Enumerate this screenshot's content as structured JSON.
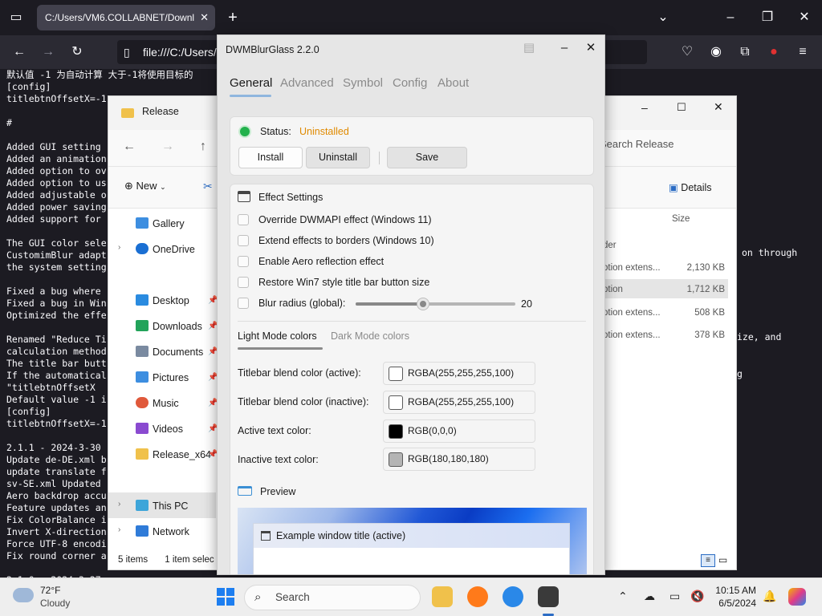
{
  "browser": {
    "tab_title": "C:/Users/VM6.COLLABNET/Downl",
    "url": "file:///C:/Users/",
    "console_lines": [
      "默认值 -1 为自动计算 大于-1将使用目标的",
      "[config]",
      "titlebtnOffsetX=-1",
      "",
      "#",
      "",
      "Added GUI setting",
      "Added an animation",
      "Added option to ov",
      "Added option to us",
      "Added adjustable o",
      "Added power saving",
      "Added support for",
      "",
      "The GUI color sele",
      "CustomimBlur adapt",
      "the system setting",
      "",
      "Fixed a bug where",
      "Fixed a bug in Win",
      "Optimized the effe",
      "",
      "Renamed \"Reduce Ti",
      "calculation method",
      "The title bar butt",
      "If the automatical",
      "\"titlebtnOffsetX",
      "Default value -1 i",
      "[config]",
      "titlebtnOffsetX=-1",
      "",
      "2.1.1 - 2024-3-30",
      "Update de-DE.xml b",
      "update translate f",
      "sv-SE.xml Updated",
      "Aero backdrop accu",
      "Feature updates an",
      "Fix ColorBalance i",
      "Invert X-direction",
      "Force UTF-8 encodi",
      "Fix round corner a",
      "",
      "2.1.0 - 2024-3-27"
    ],
    "right_text_1": "on through",
    "right_text_2": "ize, and",
    "right_text_3": "g"
  },
  "explorer": {
    "title": "Release",
    "search_placeholder": "Search Release",
    "new_label": "New",
    "details_label": "Details",
    "size_header": "Size",
    "sidebar": [
      "Gallery",
      "OneDrive",
      "Desktop",
      "Downloads",
      "Documents",
      "Pictures",
      "Music",
      "Videos",
      "Release_x64",
      "This PC",
      "Network"
    ],
    "rows": [
      {
        "name": "der",
        "size": ""
      },
      {
        "name": "otion extens...",
        "size": "2,130 KB"
      },
      {
        "name": "otion",
        "size": "1,712 KB"
      },
      {
        "name": "otion extens...",
        "size": "508 KB"
      },
      {
        "name": "otion extens...",
        "size": "378 KB"
      }
    ],
    "status_items": "5 items",
    "status_selected": "1 item selec"
  },
  "dwm": {
    "title": "DWMBlurGlass 2.2.0",
    "tabs": [
      "General",
      "Advanced",
      "Symbol",
      "Config",
      "About"
    ],
    "status_label": "Status:",
    "status_value": "Uninstalled",
    "status_color": "#e08a00",
    "install_label": "Install",
    "uninstall_label": "Uninstall",
    "save_label": "Save",
    "effect_heading": "Effect Settings",
    "options": [
      "Override DWMAPI effect (Windows 11)",
      "Extend effects to borders (Windows 10)",
      "Enable Aero reflection effect",
      "Restore Win7 style title bar button size"
    ],
    "blur_label": "Blur radius (global):",
    "blur_value": "20",
    "blur_fraction": 0.42,
    "color_tabs": [
      "Light Mode colors",
      "Dark Mode colors"
    ],
    "colors": [
      {
        "label": "Titlebar blend color (active):",
        "value": "RGBA(255,255,255,100)",
        "swatch": "#ffffff"
      },
      {
        "label": "Titlebar blend color (inactive):",
        "value": "RGBA(255,255,255,100)",
        "swatch": "#ffffff"
      },
      {
        "label": "Active text color:",
        "value": "RGB(0,0,0)",
        "swatch": "#000000"
      },
      {
        "label": "Inactive text color:",
        "value": "RGB(180,180,180)",
        "swatch": "#b4b4b4"
      }
    ],
    "preview_heading": "Preview",
    "preview_window_title": "Example window title (active)"
  },
  "taskbar": {
    "temperature": "72°F",
    "condition": "Cloudy",
    "search_label": "Search",
    "time": "10:15 AM",
    "date": "6/5/2024"
  }
}
